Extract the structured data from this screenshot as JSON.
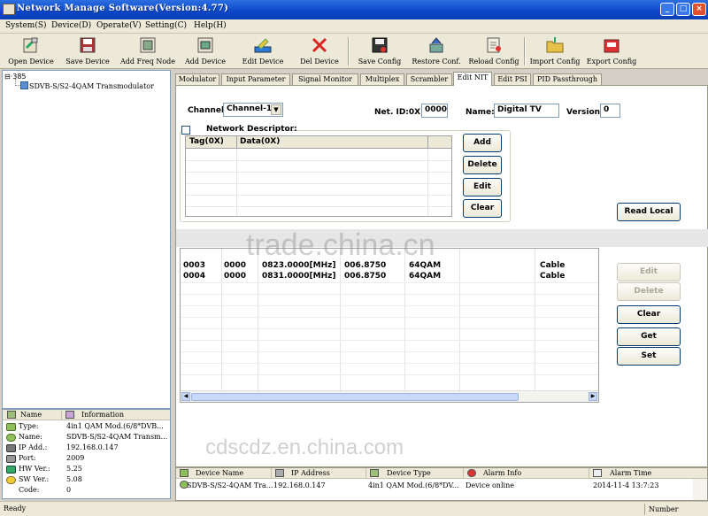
{
  "window": {
    "title": "Network Manage Software(Version:4.77)",
    "min": "_",
    "max": "□",
    "close": "×"
  },
  "menu": [
    "System(S)",
    "Device(D)",
    "Operate(V)",
    "Setting(C)",
    "Help(H)"
  ],
  "toolbar": {
    "open_device": "Open Device",
    "save_device": "Save Device",
    "add_freq_node": "Add Freq Node",
    "add_device": "Add Device",
    "edit_device": "Edit Device",
    "del_device": "Del Device",
    "save_config": "Save Config",
    "restore_conf": "Restore Conf.",
    "reload_config": "Reload Config",
    "import_config": "Import Config",
    "export_config": "Export Config"
  },
  "tree": {
    "root": "385",
    "root_prefix": "⊟",
    "device": "SDVB-S/S2-4QAM Transmodulator"
  },
  "info": {
    "header_name": "Name",
    "header_info": "Information",
    "rows": [
      {
        "key": "Type:",
        "value": "4in1 QAM Mod.(6/8*DVB..."
      },
      {
        "key": "Name:",
        "value": "SDVB-S/S2-4QAM Transm..."
      },
      {
        "key": "IP Add.:",
        "value": "192.168.0.147"
      },
      {
        "key": "Port:",
        "value": "2009"
      },
      {
        "key": "HW Ver.:",
        "value": "5.25"
      },
      {
        "key": "SW Ver.:",
        "value": "5.08"
      },
      {
        "key": "Code:",
        "value": "0"
      }
    ]
  },
  "tabs": [
    "Modulator",
    "Input Parameter",
    "Signal Monitor",
    "Multiplex",
    "Scrambler",
    "Edit NIT",
    "Edit PSI",
    "PID Passthrough"
  ],
  "active_tab": "Edit NIT",
  "nit": {
    "channel_label": "Channel",
    "channel_value": "Channel-1",
    "net_id_label": "Net. ID:0X",
    "net_id_value": "0000",
    "name_label": "Name:",
    "name_value": "Digital TV",
    "version_label": "Version",
    "version_value": "0",
    "network_descriptor_label": "Network Descriptor:",
    "table_headers": [
      "Tag(0X)",
      "Data(0X)"
    ],
    "buttons": {
      "add": "Add",
      "delete": "Delete",
      "edit": "Edit",
      "clear": "Clear"
    }
  },
  "transport_list": {
    "rows": [
      [
        "0003",
        "0000",
        "0823.0000[MHz]",
        "006.8750",
        "64QAM",
        "Cable"
      ],
      [
        "0004",
        "0000",
        "0831.0000[MHz]",
        "006.8750",
        "64QAM",
        "Cable"
      ]
    ]
  },
  "right_buttons": {
    "read_local": "Read Local",
    "edit": "Edit",
    "delete": "Delete",
    "clear": "Clear",
    "get": "Get",
    "set": "Set"
  },
  "alarm": {
    "headers": [
      "Device Name",
      "IP Address",
      "Device Type",
      "Alarm Info",
      "Alarm Time"
    ],
    "row": [
      "SDVB-S/S2-4QAM Tra...",
      "192.168.0.147",
      "4in1 QAM Mod.(6/8*DV...",
      "Device online",
      "2014-11-4 13:7:23"
    ]
  },
  "status": {
    "left": "Ready",
    "right": "Number"
  },
  "watermarks": {
    "center": "trade.china.cn",
    "bottom": "cdscdz.en.china.com"
  }
}
